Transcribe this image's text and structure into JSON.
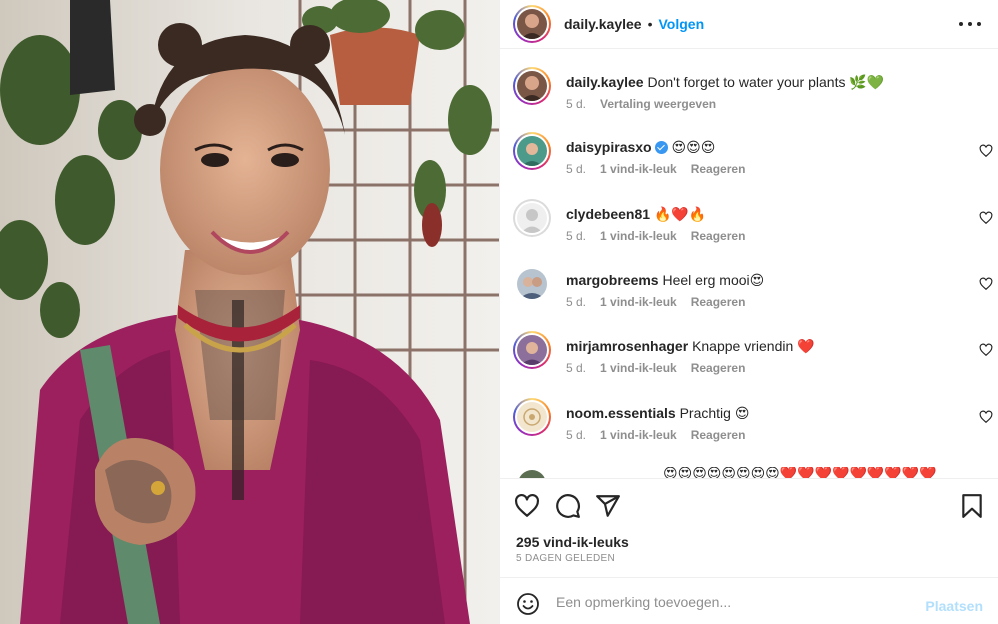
{
  "post": {
    "username": "daily.kaylee",
    "separator": "•",
    "follow_label": "Volgen",
    "more_icon": "more-horizontal-icon"
  },
  "caption": {
    "username": "daily.kaylee",
    "text": "Don't forget to water your plants 🌿💚",
    "age": "5 d.",
    "translate_label": "Vertaling weergeven"
  },
  "comments": [
    {
      "username": "daisypirasxo",
      "verified": true,
      "text": "😍😍😍",
      "age": "5 d.",
      "likes": "1 vind-ik-leuk",
      "reply": "Reageren"
    },
    {
      "username": "clydebeen81",
      "verified": false,
      "text": "🔥❤️🔥",
      "age": "5 d.",
      "likes": "1 vind-ik-leuk",
      "reply": "Reageren"
    },
    {
      "username": "margobreems",
      "verified": false,
      "text": "Heel erg mooi😍",
      "age": "5 d.",
      "likes": "1 vind-ik-leuk",
      "reply": "Reageren"
    },
    {
      "username": "mirjamrosenhager",
      "verified": false,
      "text": "Knappe vriendin ❤️",
      "age": "5 d.",
      "likes": "1 vind-ik-leuk",
      "reply": "Reageren"
    },
    {
      "username": "noom.essentials",
      "verified": false,
      "text": "Prachtig 😍",
      "age": "5 d.",
      "likes": "1 vind-ik-leuk",
      "reply": "Reageren"
    }
  ],
  "partial_comment": "😍😍😍😍😍😍😍😍❤️❤️❤️❤️❤️❤️❤️❤️❤️",
  "actions": {
    "like_icon": "heart-icon",
    "comment_icon": "comment-icon",
    "share_icon": "send-icon",
    "save_icon": "bookmark-icon"
  },
  "stats": {
    "likes": "295 vind-ik-leuks",
    "posted": "5 DAGEN GELEDEN"
  },
  "composer": {
    "placeholder": "Een opmerking toevoegen...",
    "value": "",
    "post_label": "Plaatsen"
  },
  "colors": {
    "link_blue": "#0095f6",
    "post_disabled": "#b2dffc",
    "meta_gray": "#8e8e8e"
  }
}
